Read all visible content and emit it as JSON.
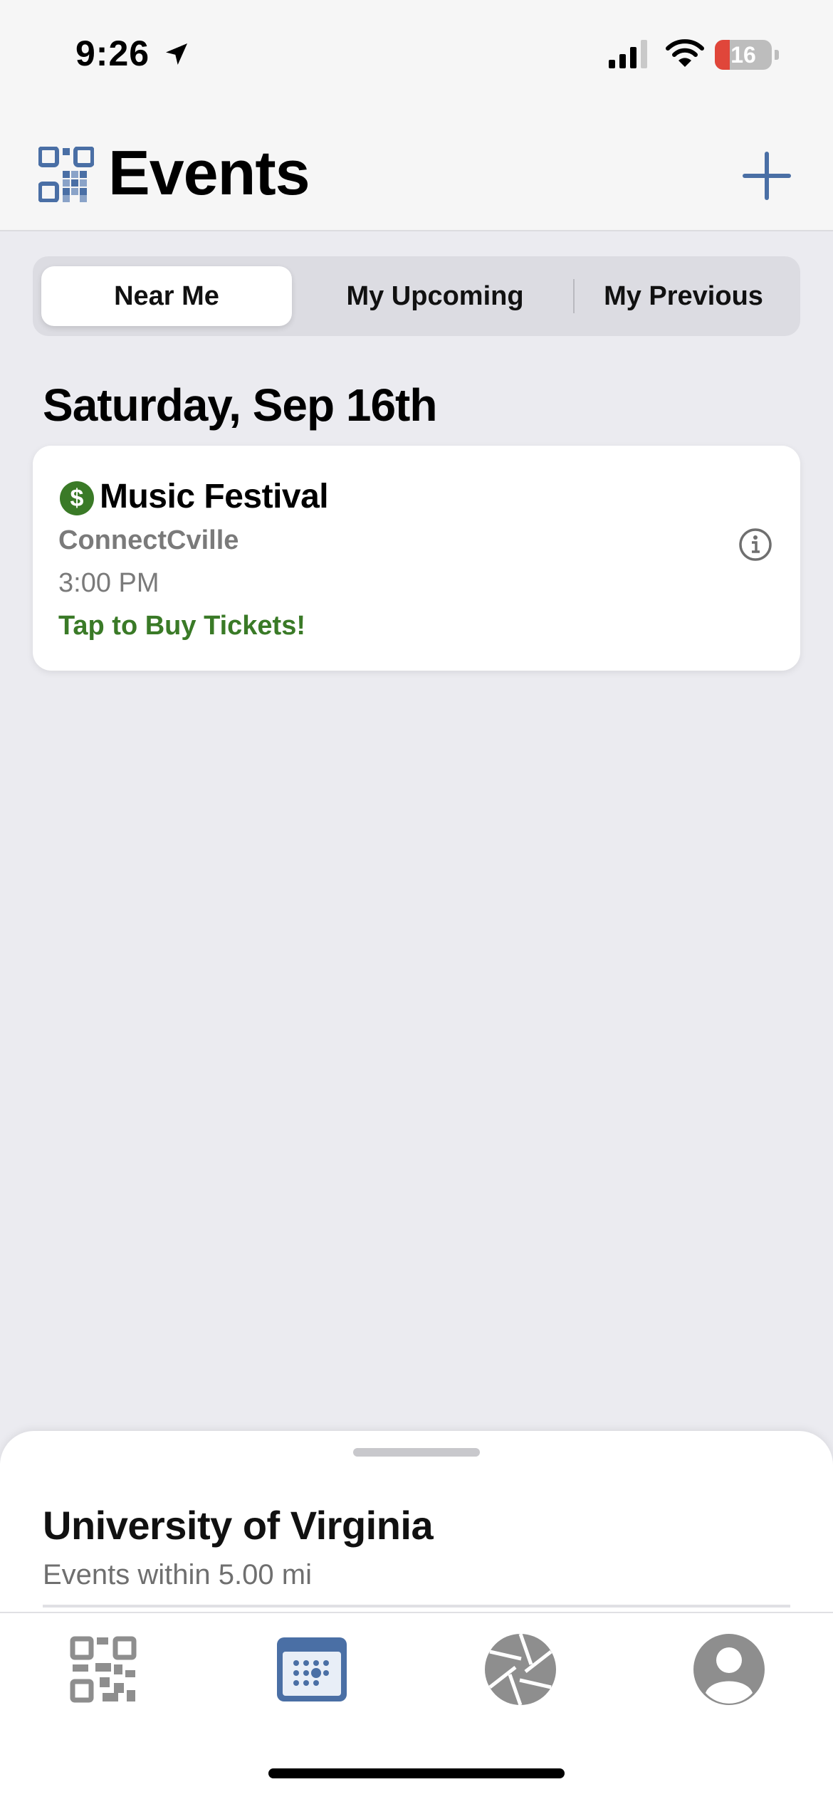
{
  "status_bar": {
    "time": "9:26",
    "battery": "16",
    "battery_level": 0.16
  },
  "header": {
    "title": "Events",
    "add_label": "+"
  },
  "segments": [
    {
      "label": "Near Me",
      "selected": true
    },
    {
      "label": "My Upcoming",
      "selected": false
    },
    {
      "label": "My Previous",
      "selected": false
    }
  ],
  "section": {
    "date": "Saturday, Sep 16th"
  },
  "events": [
    {
      "name": "Music Festival",
      "organizer": "ConnectCville",
      "time": "3:00 PM",
      "cta": "Tap to Buy Tickets!",
      "paid_icon": "dollar-icon",
      "icon_symbol": "$"
    }
  ],
  "location_sheet": {
    "title": "University of Virginia",
    "subtitle": "Events within 5.00 mi"
  },
  "tab_bar": {
    "items": [
      {
        "icon": "qr-code-icon",
        "selected": false
      },
      {
        "icon": "calendar-icon",
        "selected": true
      },
      {
        "icon": "camera-aperture-icon",
        "selected": false
      },
      {
        "icon": "profile-icon",
        "selected": false
      }
    ]
  },
  "colors": {
    "accent": "#4a6fa5",
    "paid_green": "#3a7a27",
    "battery_low": "#e0463a",
    "inactive_icon": "#8e8e8e"
  }
}
